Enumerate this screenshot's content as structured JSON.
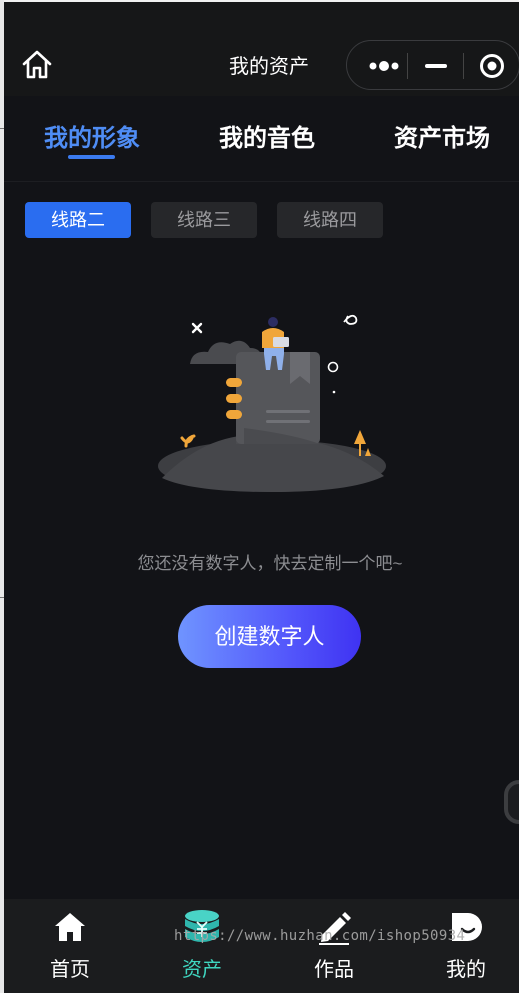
{
  "header": {
    "title": "我的资产"
  },
  "tabs": [
    {
      "label": "我的形象",
      "active": true
    },
    {
      "label": "我的音色",
      "active": false
    },
    {
      "label": "资产市场",
      "active": false
    }
  ],
  "lines": [
    {
      "label": "线路二",
      "active": true
    },
    {
      "label": "线路三",
      "active": false
    },
    {
      "label": "线路四",
      "active": false
    }
  ],
  "empty": {
    "message": "您还没有数字人，快去定制一个吧~",
    "button": "创建数字人"
  },
  "nav": [
    {
      "label": "首页",
      "icon": "home-icon",
      "active": false
    },
    {
      "label": "资产",
      "icon": "database-icon",
      "active": true
    },
    {
      "label": "作品",
      "icon": "pen-icon",
      "active": false
    },
    {
      "label": "我的",
      "icon": "profile-icon",
      "active": false
    }
  ],
  "watermark": "https://www.huzhan.com/ishop50934",
  "colors": {
    "accent": "#2a6df0",
    "active_nav": "#3fd6c0",
    "background": "#121317"
  }
}
